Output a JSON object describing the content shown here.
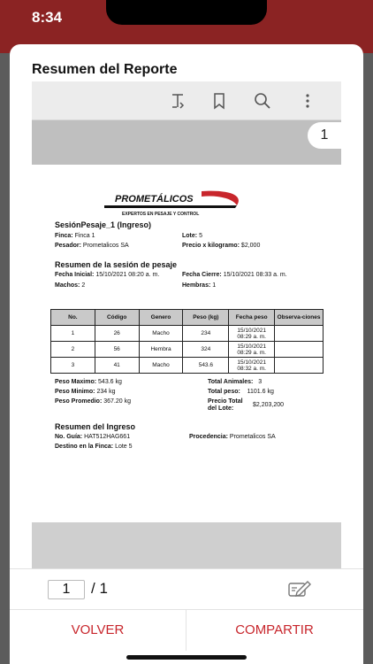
{
  "status": {
    "time": "8:34"
  },
  "header": {
    "title": "Resumen del Reporte"
  },
  "toolbar": {
    "icons": [
      "text-select-icon",
      "bookmark-icon",
      "search-icon",
      "more-vertical-icon"
    ]
  },
  "viewer": {
    "page_badge": "1"
  },
  "report": {
    "logo_text": "PROMETÁLICOS",
    "logo_tagline": "EXPERTOS EN PESAJE Y CONTROL",
    "session_title": "SesiónPesaje_1 (Ingreso)",
    "finca_label": "Finca:",
    "finca_value": "Finca 1",
    "lote_label": "Lote:",
    "lote_value": "5",
    "pesador_label": "Pesador:",
    "pesador_value": "Prometalicos SA",
    "precio_label": "Precio x kilogramo:",
    "precio_value": "$2,000",
    "resumen_sesion_title": "Resumen de la sesión de pesaje",
    "fecha_inicial_label": "Fecha Inicial:",
    "fecha_inicial_value": "15/10/2021 08:20 a. m.",
    "fecha_cierre_label": "Fecha Cierre:",
    "fecha_cierre_value": "15/10/2021 08:33 a. m.",
    "machos_label": "Machos:",
    "machos_value": "2",
    "hembras_label": "Hembras:",
    "hembras_value": "1",
    "table": {
      "headers": [
        "No.",
        "Código",
        "Genero",
        "Peso (kg)",
        "Fecha peso",
        "Observa-ciones"
      ],
      "rows": [
        [
          "1",
          "26",
          "Macho",
          "234",
          "15/10/2021 08:29 a. m.",
          ""
        ],
        [
          "2",
          "56",
          "Hembra",
          "324",
          "15/10/2021 08:29 a. m.",
          ""
        ],
        [
          "3",
          "41",
          "Macho",
          "543.6",
          "15/10/2021 08:32 a. m.",
          ""
        ]
      ]
    },
    "peso_maximo_label": "Peso Maximo:",
    "peso_maximo_value": "543.6 kg",
    "peso_minimo_label": "Peso Minimo:",
    "peso_minimo_value": "234 kg",
    "peso_promedio_label": "Peso Promedio:",
    "peso_promedio_value": "367.20 kg",
    "total_animales_label": "Total Animales:",
    "total_animales_value": "3",
    "total_peso_label": "Total peso:",
    "total_peso_value": "1101.6 kg",
    "precio_total_label_1": "Precio Total",
    "precio_total_label_2": "del Lote:",
    "precio_total_value": "$2,203,200",
    "resumen_ingreso_title": "Resumen del Ingreso",
    "guia_label": "No. Guía:",
    "guia_value": "HAT512HAG661",
    "procedencia_label": "Procedencia:",
    "procedencia_value": "Prometalicos SA",
    "destino_label": "Destino en la Finca:",
    "destino_value": "Lote 5"
  },
  "pager": {
    "current": "1",
    "separator": "/ 1"
  },
  "actions": {
    "volver": "VOLVER",
    "compartir": "COMPARTIR"
  },
  "colors": {
    "accent": "#c8262c",
    "status_bar": "#8b2323"
  }
}
